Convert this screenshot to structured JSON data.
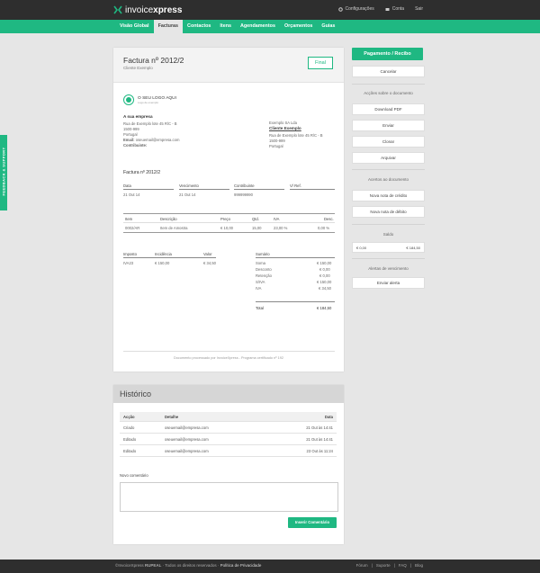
{
  "app": {
    "logo_light": "invoice",
    "logo_bold": "xpress",
    "top_links": [
      "Configurações",
      "Conta",
      "Sair"
    ]
  },
  "nav": {
    "items": [
      "Visão Global",
      "Facturas",
      "Contactos",
      "Itens",
      "Agendamentos",
      "Orçamentos",
      "Guias"
    ],
    "active": "Facturas"
  },
  "document": {
    "title": "Factura nº 2012/2",
    "subtitle": "Cliente Exemplo",
    "status_button": "Final",
    "logo_text": "O SEU LOGO AQUI",
    "logo_subtext": "Logo de exemplo",
    "company": {
      "name": "A sua empresa",
      "address1": "Rua de Exemplo lote 45 R/C - B",
      "postal": "1500-999",
      "country": "Portugal",
      "email_label": "Email:",
      "email": "oseuemail@empresa.com",
      "taxpayer_label": "Contribuinte:"
    },
    "client": {
      "company": "Exemplo SA Lda",
      "name": "Cliente Exemplo",
      "address1": "Rua de Exemplo lote 45 R/C - B",
      "postal": "1500-999",
      "country": "Portugal"
    },
    "invoice_label": "Factura nº 2012/2",
    "meta_headers": [
      "Data",
      "Vencimento",
      "Contribuinte",
      "V/ Ref."
    ],
    "meta_values": [
      "21 Out 14",
      "21 Out 14",
      "999999990",
      ""
    ],
    "item_headers": [
      "Item",
      "Descrição",
      "Preço",
      "Qtd.",
      "IVA",
      "Desc."
    ],
    "items": [
      [
        "0002/AR",
        "Item de Amostra",
        "€ 10,00",
        "15,00",
        "23,00 %",
        "0,00 %"
      ]
    ],
    "tax_headers": [
      "Imposto",
      "Incidência",
      "Valor"
    ],
    "taxes": [
      [
        "IVA23",
        "€ 150,00",
        "€ 34,50"
      ]
    ],
    "summary_title": "Sumário",
    "summary": [
      [
        "Soma",
        "€ 150,00"
      ],
      [
        "Desconto",
        "€ 0,00"
      ],
      [
        "Retenção",
        "€ 0,00"
      ],
      [
        "S/IVA",
        "€ 150,00"
      ],
      [
        "IVA",
        "€ 34,50"
      ]
    ],
    "total_label": "Total",
    "total_value": "€ 184,50",
    "footer_note": "Documento processado por InvoiceXpress - Programa certificado nº 192"
  },
  "sidebar": {
    "primary_button": "Pagamento / Recibo",
    "cancel_button": "Cancelar",
    "actions_title": "Acções sobre o documento",
    "actions": [
      "Download PDF",
      "Enviar",
      "Clonar",
      "Arquivar"
    ],
    "adjust_title": "Acertos ao documento",
    "adjust": [
      "Nova nota de crédito",
      "Nova nota de débito"
    ],
    "balance_title": "Saldo",
    "balance_left": "€ 0,00",
    "balance_right": "€ 184,50",
    "alerts_title": "Alertas de vencimento",
    "alert_button": "Enviar alerta"
  },
  "history": {
    "title": "Histórico",
    "headers": [
      "Acção",
      "Detalhe",
      "Data"
    ],
    "rows": [
      [
        "Criado",
        "oseuemail@empresa.com",
        "21 Out às 14:41"
      ],
      [
        "Editado",
        "oseuemail@empresa.com",
        "21 Out às 14:41"
      ],
      [
        "Editado",
        "oseuemail@empresa.com",
        "23 Out às 11:24"
      ]
    ],
    "comment_label": "Novo comentário",
    "submit_button": "Inserir Comentário"
  },
  "feedback_tab": "FEEDBACK & SUPPORT",
  "footer": {
    "left_prefix": "©InvoiceXpress",
    "left_bold": "RUPEAL",
    "left_rest": "· Todos os direitos reservados ·",
    "left_link": "Política de Privacidade",
    "right_links": [
      "Fórum",
      "Suporte",
      "FAQ",
      "Blog"
    ]
  },
  "colors": {
    "accent": "#1fb882",
    "topbar": "#2e2e2e",
    "background": "#e6e6e6"
  }
}
